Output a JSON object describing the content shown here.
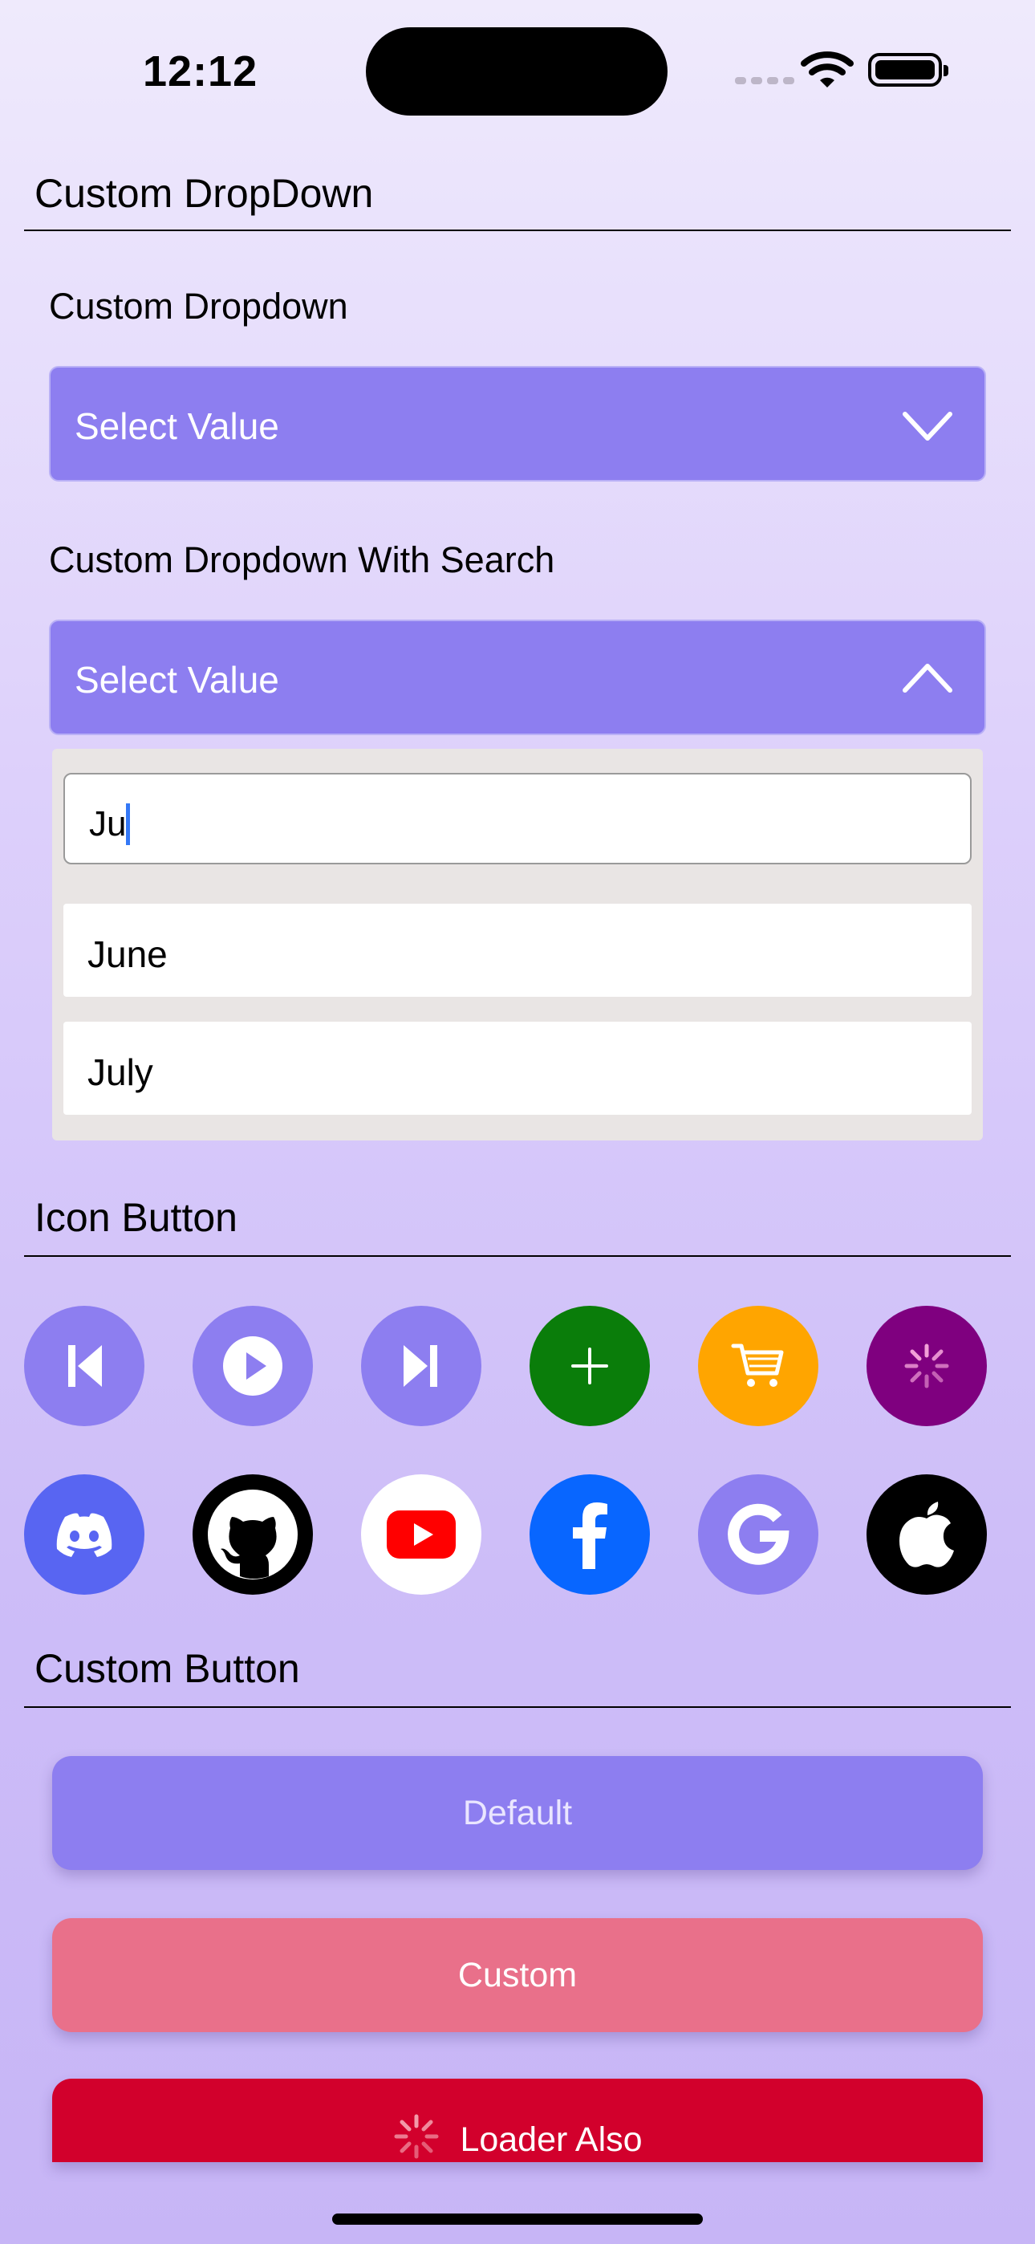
{
  "status_bar": {
    "time": "12:12"
  },
  "sections": {
    "dropdown_title": "Custom DropDown",
    "icon_button_title": "Icon Button",
    "custom_button_title": "Custom Button"
  },
  "dropdown1": {
    "label": "Custom Dropdown",
    "value": "Select Value",
    "state": "collapsed"
  },
  "dropdown2": {
    "label": "Custom Dropdown With Search",
    "value": "Select Value",
    "state": "expanded",
    "search_text": "Ju",
    "options": [
      "June",
      "July"
    ]
  },
  "icon_buttons": {
    "row1": [
      {
        "icon": "skip-back-icon",
        "color": "#8d7ef0"
      },
      {
        "icon": "play-icon",
        "color": "#8d7ef0"
      },
      {
        "icon": "skip-forward-icon",
        "color": "#8d7ef0"
      },
      {
        "icon": "plus-icon",
        "color": "#0a7d0a"
      },
      {
        "icon": "cart-icon",
        "color": "#ffa500"
      },
      {
        "icon": "spinner-icon",
        "color": "#7f007f"
      }
    ],
    "row2": [
      {
        "icon": "discord-icon",
        "color": "#5865f2"
      },
      {
        "icon": "github-icon",
        "color": "#000000"
      },
      {
        "icon": "youtube-icon",
        "color": "#ffffff"
      },
      {
        "icon": "facebook-icon",
        "color": "#0866ff"
      },
      {
        "icon": "google-icon",
        "color": "#8d7ef0"
      },
      {
        "icon": "apple-icon",
        "color": "#000000"
      }
    ]
  },
  "buttons": {
    "default_label": "Default",
    "custom_label": "Custom",
    "loader_label": "Loader Also",
    "colors": {
      "default": "#8d7ef0",
      "custom": "#e9708a",
      "loader": "#d2002c"
    }
  }
}
